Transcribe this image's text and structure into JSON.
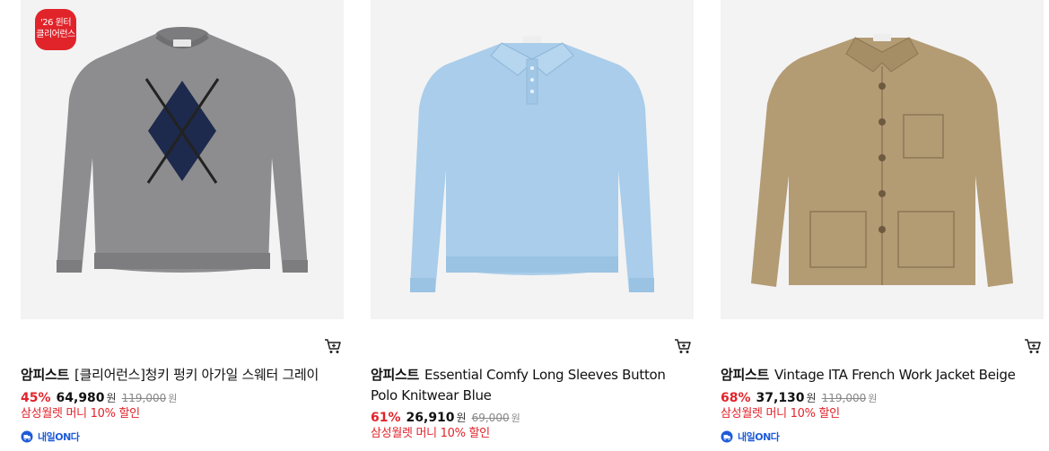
{
  "colors": {
    "accent_red": "#e1232a",
    "delivery_blue": "#1e5bd8",
    "thumb_bg": "#f3f3f3"
  },
  "products": [
    {
      "badge_line1": "'26 윈터",
      "badge_line2": "클리어런스",
      "brand": "암피스트",
      "name": "[클리어런스]청키 펑키 아가일 스웨터 그레이",
      "discount": "45%",
      "price": "64,980",
      "currency": "원",
      "original_price": "119,000",
      "original_currency": "원",
      "promo": "삼성월렛 머니 10% 할인",
      "delivery": "내일ON다",
      "cart_icon": "cart-icon"
    },
    {
      "brand": "암피스트",
      "name": "Essential Comfy Long Sleeves Button Polo Knitwear Blue",
      "discount": "61%",
      "price": "26,910",
      "currency": "원",
      "original_price": "69,000",
      "original_currency": "원",
      "promo": "삼성월렛 머니 10% 할인",
      "cart_icon": "cart-icon"
    },
    {
      "brand": "암피스트",
      "name": "Vintage ITA French Work Jacket Beige",
      "discount": "68%",
      "price": "37,130",
      "currency": "원",
      "original_price": "119,000",
      "original_currency": "원",
      "promo": "삼성월렛 머니 10% 할인",
      "delivery": "내일ON다",
      "cart_icon": "cart-icon"
    }
  ]
}
